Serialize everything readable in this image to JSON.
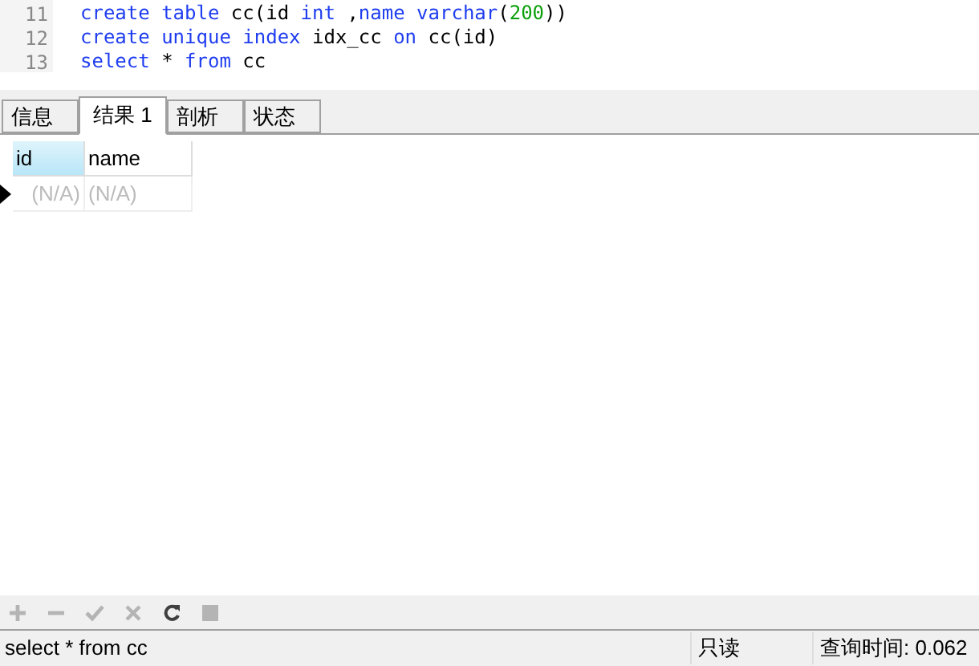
{
  "editor": {
    "lines": [
      {
        "number": "11",
        "tokens": [
          {
            "text": "create table",
            "kind": "keyword"
          },
          {
            "text": " cc(id ",
            "kind": "plain"
          },
          {
            "text": "int",
            "kind": "keyword"
          },
          {
            "text": " ,",
            "kind": "plain"
          },
          {
            "text": "name varchar",
            "kind": "keyword"
          },
          {
            "text": "(",
            "kind": "plain"
          },
          {
            "text": "200",
            "kind": "number"
          },
          {
            "text": "))",
            "kind": "plain"
          }
        ]
      },
      {
        "number": "12",
        "tokens": [
          {
            "text": "create unique index",
            "kind": "keyword"
          },
          {
            "text": " idx_cc ",
            "kind": "plain"
          },
          {
            "text": "on",
            "kind": "keyword"
          },
          {
            "text": " cc(id)",
            "kind": "plain"
          }
        ]
      },
      {
        "number": "13",
        "tokens": [
          {
            "text": "select",
            "kind": "keyword"
          },
          {
            "text": " * ",
            "kind": "plain"
          },
          {
            "text": "from",
            "kind": "keyword"
          },
          {
            "text": " cc",
            "kind": "plain"
          }
        ]
      }
    ]
  },
  "tabs": [
    {
      "label": "信息",
      "selected": false
    },
    {
      "label": "结果 1",
      "selected": true
    },
    {
      "label": "剖析",
      "selected": false
    },
    {
      "label": "状态",
      "selected": false
    }
  ],
  "grid": {
    "columns": [
      {
        "label": "id",
        "selected": true
      },
      {
        "label": "name",
        "selected": false
      }
    ],
    "rows": [
      {
        "current": true,
        "cells": [
          "(N/A)",
          "(N/A)"
        ]
      }
    ]
  },
  "toolbar": [
    {
      "kind": "add",
      "disabled": true
    },
    {
      "kind": "delete",
      "disabled": true
    },
    {
      "kind": "apply",
      "disabled": true
    },
    {
      "kind": "cancel",
      "disabled": true
    },
    {
      "kind": "refresh",
      "disabled": false
    },
    {
      "kind": "stop",
      "disabled": true
    }
  ],
  "status_bar": {
    "query": "select * from cc",
    "mode": "只读",
    "time": "查询时间: 0.062"
  }
}
